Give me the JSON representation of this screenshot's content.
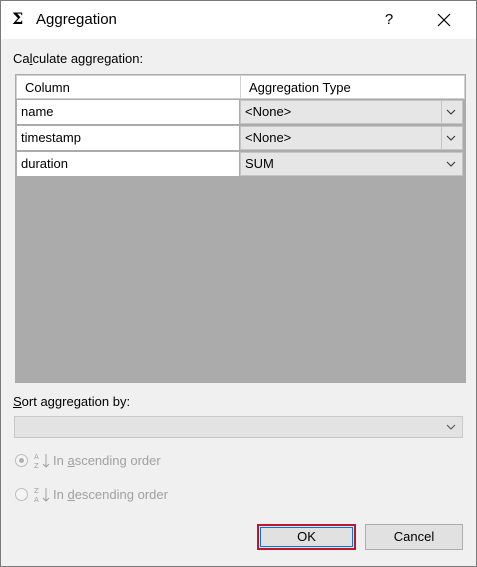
{
  "window": {
    "title": "Aggregation",
    "title_icon": "sigma-icon",
    "help": "?",
    "close": "close-icon"
  },
  "calc_label_pre": "Ca",
  "calc_label_u": "l",
  "calc_label_post": "culate aggregation:",
  "grid": {
    "headers": [
      "Column",
      "Aggregation Type"
    ],
    "rows": [
      {
        "column": "name",
        "type": "<None>"
      },
      {
        "column": "timestamp",
        "type": "<None>"
      },
      {
        "column": "duration",
        "type": "SUM"
      }
    ]
  },
  "sort_label_u": "S",
  "sort_label_post": "ort aggregation by:",
  "sort_value": "",
  "radio_asc": {
    "pre": "In ",
    "u": "a",
    "post": "scending order",
    "checked": true,
    "enabled": false
  },
  "radio_desc": {
    "pre": "In ",
    "u": "d",
    "post": "escending order",
    "checked": false,
    "enabled": false
  },
  "buttons": {
    "ok": "OK",
    "cancel": "Cancel"
  },
  "colors": {
    "grid_background": "#ababab",
    "ok_focus_border": "#c0152b"
  }
}
